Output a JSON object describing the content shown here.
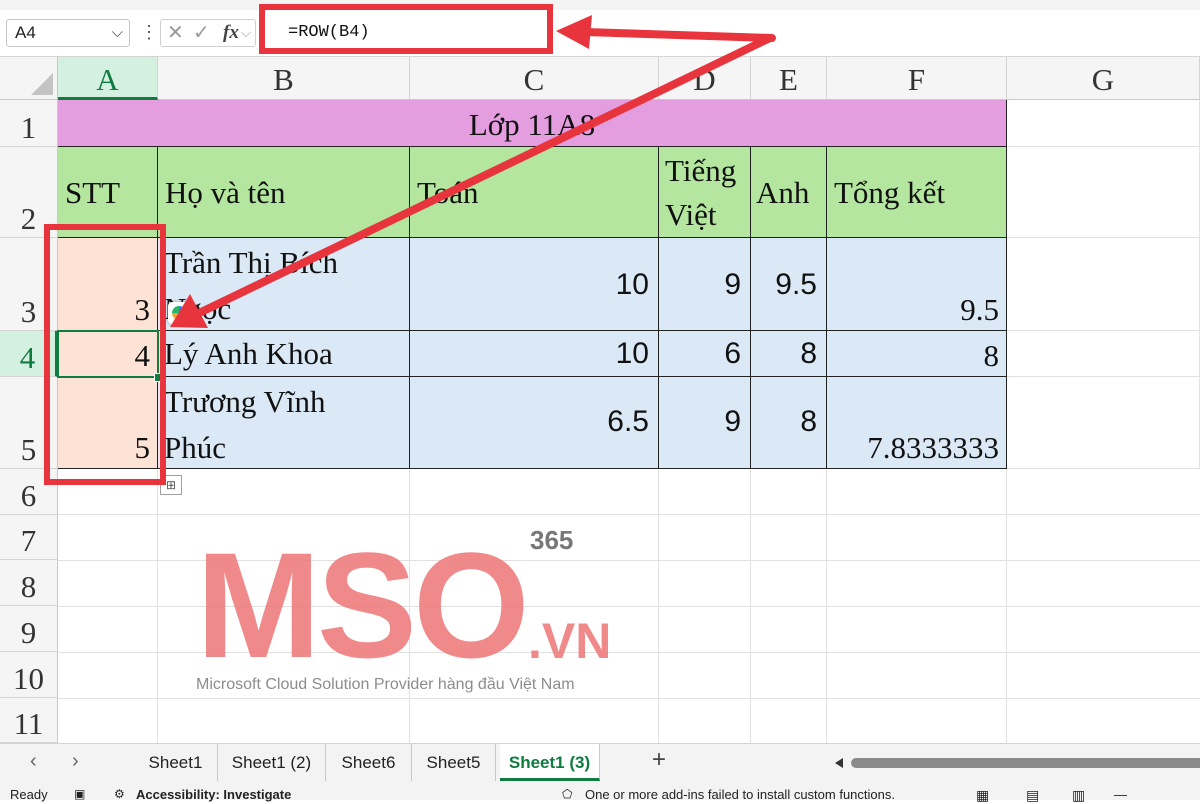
{
  "formula_bar": {
    "name_box": "A4",
    "name_chevron": "⌵",
    "more": "⋮",
    "cancel": "✕",
    "enter": "✓",
    "fx": "fx",
    "fx_chevron": "⌵",
    "formula": "=ROW(B4)"
  },
  "columns": [
    "A",
    "B",
    "C",
    "D",
    "E",
    "F",
    "G"
  ],
  "rows": [
    "1",
    "2",
    "3",
    "4",
    "5",
    "6",
    "7",
    "8",
    "9",
    "10",
    "11"
  ],
  "selected": {
    "column": "A",
    "row": "4"
  },
  "sheet": {
    "title": "Lớp 11A8",
    "headers": {
      "stt": "STT",
      "name": "Họ và tên",
      "math": "Toán",
      "viet_line1": "Tiếng",
      "viet_line2": "Việt",
      "eng": "Anh",
      "total": "Tổng kết"
    },
    "records": [
      {
        "stt": "3",
        "name_line1": "Trần Thị Bích",
        "name_line2": "Ngọc",
        "math": "10",
        "viet": "9",
        "eng": "9.5",
        "total": "9.5"
      },
      {
        "stt": "4",
        "name_line1": "Lý Anh Khoa",
        "name_line2": "",
        "math": "10",
        "viet": "6",
        "eng": "8",
        "total": "8"
      },
      {
        "stt": "5",
        "name_line1": "Trương Vĩnh",
        "name_line2": "Phúc",
        "math": "6.5",
        "viet": "9",
        "eng": "8",
        "total": "7.8333333"
      }
    ]
  },
  "watermark": {
    "brand": "MSO",
    "suffix": ".VN",
    "badge": "365",
    "tagline": "Microsoft Cloud Solution Provider hàng đầu Việt Nam"
  },
  "tabs": {
    "prev": "‹",
    "next": "›",
    "items": [
      "Sheet1",
      "Sheet1 (2)",
      "Sheet6",
      "Sheet5",
      "Sheet1 (3)"
    ],
    "active": "Sheet1 (3)",
    "add": "+"
  },
  "status": {
    "ready": "Ready",
    "accessibility": "Accessibility: Investigate",
    "addins": "One or more add-ins failed to install custom functions.",
    "zoom_minus": "—"
  },
  "colors": {
    "title_fill": "#e49ee0",
    "header_fill": "#b4e6a0",
    "data_fill": "#dbe9f6",
    "stt_fill": "#fde2d6",
    "highlight": "#e8353d",
    "excel_green": "#107c41",
    "watermark": "#ef7f7f"
  }
}
